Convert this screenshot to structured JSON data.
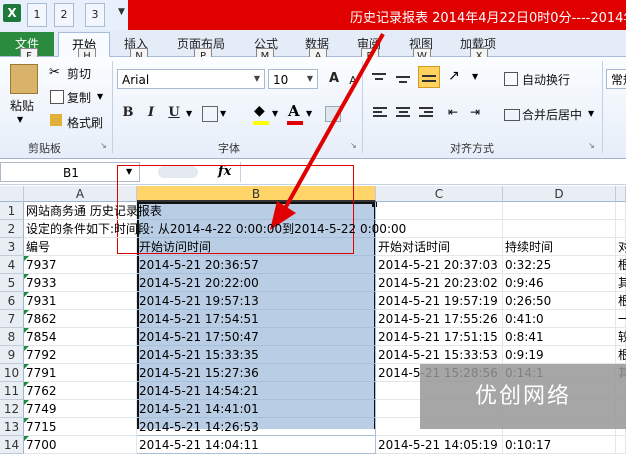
{
  "window": {
    "title": "历史记录报表 2014年4月22日0时0分----2014年",
    "app_icon": "excel-icon"
  },
  "quick_access": {
    "keytips": [
      "1",
      "2",
      "3"
    ]
  },
  "tabs": {
    "file": "文件",
    "home": "开始",
    "insert": "插入",
    "page_layout": "页面布局",
    "formulas": "公式",
    "data": "数据",
    "review": "审阅",
    "view": "视图",
    "addins": "加载项"
  },
  "keytips": {
    "file": "F",
    "home": "H",
    "insert": "N",
    "page_layout": "P",
    "formulas": "M",
    "data": "A",
    "review": "R",
    "view": "W",
    "addins": "X"
  },
  "ribbon": {
    "clipboard": {
      "paste": "粘贴",
      "cut": "剪切",
      "copy": "复制",
      "format_painter": "格式刷",
      "group_label": "剪贴板"
    },
    "font": {
      "font_name": "Arial",
      "font_size": "10",
      "bold": "B",
      "italic": "I",
      "underline": "U",
      "grow": "A",
      "shrink": "A",
      "group_label": "字体"
    },
    "alignment": {
      "wrap_text": "自动换行",
      "merge_center": "合并后居中",
      "group_label": "对齐方式"
    },
    "number": {
      "format": "常规"
    }
  },
  "formula_bar": {
    "name_box": "B1",
    "fx": "fx",
    "content": ""
  },
  "grid": {
    "columns": [
      "A",
      "B",
      "C",
      "D"
    ],
    "rows": [
      {
        "n": "1",
        "a": "网站商务通 历史记录报表",
        "b": "",
        "c": "",
        "d": "",
        "e": ""
      },
      {
        "n": "2",
        "a": "设定的条件如下:时间段: 从2014-4-22 0:00:00到2014-5-22 0:00:00",
        "b": "",
        "c": "",
        "d": "",
        "e": ""
      },
      {
        "n": "3",
        "a": "编号",
        "b": "开始访问时间",
        "c": "开始对话时间",
        "d": "持续时间",
        "e": "对"
      },
      {
        "n": "4",
        "a": "7937",
        "b": "2014-5-21 20:36:57",
        "c": "2014-5-21 20:37:03",
        "d": "0:32:25",
        "e": "根"
      },
      {
        "n": "5",
        "a": "7933",
        "b": "2014-5-21 20:22:00",
        "c": "2014-5-21 20:23:02",
        "d": "0:9:46",
        "e": "其"
      },
      {
        "n": "6",
        "a": "7931",
        "b": "2014-5-21 19:57:13",
        "c": "2014-5-21 19:57:19",
        "d": "0:26:50",
        "e": "根"
      },
      {
        "n": "7",
        "a": "7862",
        "b": "2014-5-21 17:54:51",
        "c": "2014-5-21 17:55:26",
        "d": "0:41:0",
        "e": "一"
      },
      {
        "n": "8",
        "a": "7854",
        "b": "2014-5-21 17:50:47",
        "c": "2014-5-21 17:51:15",
        "d": "0:8:41",
        "e": "较"
      },
      {
        "n": "9",
        "a": "7792",
        "b": "2014-5-21 15:33:35",
        "c": "2014-5-21 15:33:53",
        "d": "0:9:19",
        "e": "根"
      },
      {
        "n": "10",
        "a": "7791",
        "b": "2014-5-21 15:27:36",
        "c": "2014-5-21 15:28:56",
        "d": "0:14:1",
        "e": "其"
      },
      {
        "n": "11",
        "a": "7762",
        "b": "2014-5-21 14:54:21",
        "c": "",
        "d": "",
        "e": ""
      },
      {
        "n": "12",
        "a": "7749",
        "b": "2014-5-21 14:41:01",
        "c": "",
        "d": "",
        "e": ""
      },
      {
        "n": "13",
        "a": "7715",
        "b": "2014-5-21 14:26:53",
        "c": "",
        "d": "",
        "e": ""
      },
      {
        "n": "14",
        "a": "7700",
        "b": "2014-5-21 14:04:11",
        "c": "2014-5-21 14:05:19",
        "d": "0:10:17",
        "e": ""
      }
    ]
  },
  "watermark": {
    "text": "优创网络"
  },
  "colors": {
    "title_bar": "#e10000",
    "file_tab": "#2a8a3e",
    "selection": "#b9cde5",
    "annotation": "#e00000"
  }
}
